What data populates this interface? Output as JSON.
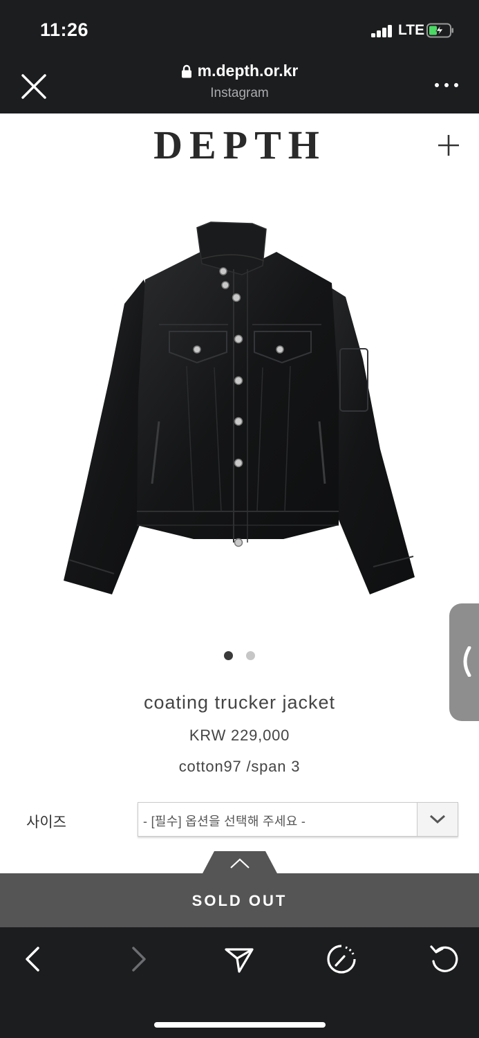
{
  "status_bar": {
    "time": "11:26",
    "network": "LTE",
    "battery_state": "charging"
  },
  "browser": {
    "url": "m.depth.or.kr",
    "source_app": "Instagram",
    "icons": [
      "close-icon",
      "lock-icon",
      "more-icon"
    ]
  },
  "site": {
    "logo": "DEPTH",
    "menu_icon": "plus-icon"
  },
  "product": {
    "name": "coating trucker jacket",
    "price": "KRW 229,000",
    "description": "cotton97 /span 3",
    "image_count": 2,
    "active_image": 1
  },
  "options": {
    "size_label": "사이즈",
    "size_select_value": "- [필수] 옵션을 선택해 주세요 -"
  },
  "buy_bar": {
    "label": "SOLD OUT"
  },
  "toolbar": {
    "icons": [
      "back-icon",
      "forward-icon",
      "share-icon",
      "speed-icon",
      "reload-icon"
    ]
  },
  "colors": {
    "chrome": "#1c1d1f",
    "soldout_bar": "#555555",
    "side_tab": "#8e8e8e"
  }
}
